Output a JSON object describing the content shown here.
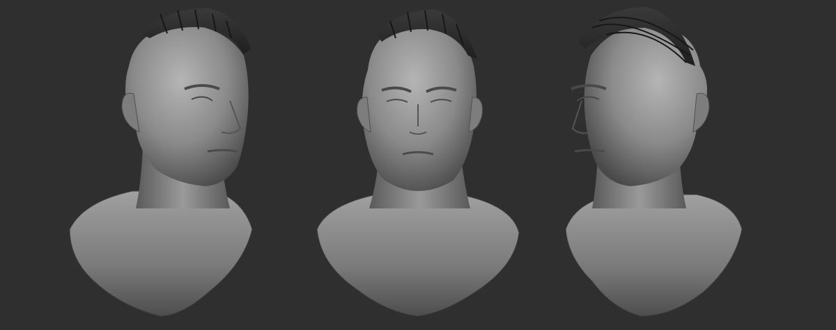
{
  "scene": {
    "background_color": "#2f2f2f",
    "clay_color": "#8a8a8a",
    "clay_dark": "#3a3a3a",
    "hair_color": "#2a2a2a",
    "views": [
      {
        "id": "three-quarter-right",
        "label": ""
      },
      {
        "id": "front",
        "label": ""
      },
      {
        "id": "three-quarter-left",
        "label": ""
      }
    ]
  }
}
